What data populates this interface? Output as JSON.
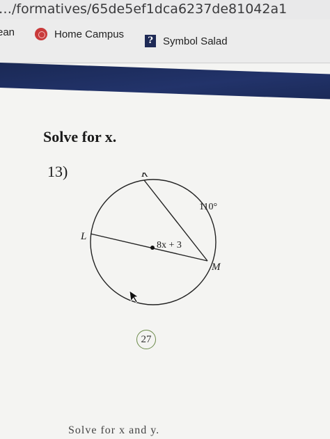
{
  "browser": {
    "url": "…/formatives/65de5ef1dca6237de81042a1",
    "bookmarks": [
      {
        "label": "ean",
        "icon": "none"
      },
      {
        "label": "Home Campus",
        "icon": "red-circle-icon"
      },
      {
        "label": "Symbol Salad",
        "icon": "question-mark-icon"
      }
    ]
  },
  "worksheet": {
    "instruction": "Solve for x.",
    "question_number": "13)",
    "diagram": {
      "point_labels": [
        "K",
        "L",
        "M"
      ],
      "arc_measure": "110°",
      "segment_expression": "8x + 3"
    },
    "answer": "27",
    "next_instruction": "Solve for x and y."
  },
  "colors": {
    "nav_strip": "#1d2c5c",
    "answer_circle": "#6b8a4a"
  }
}
